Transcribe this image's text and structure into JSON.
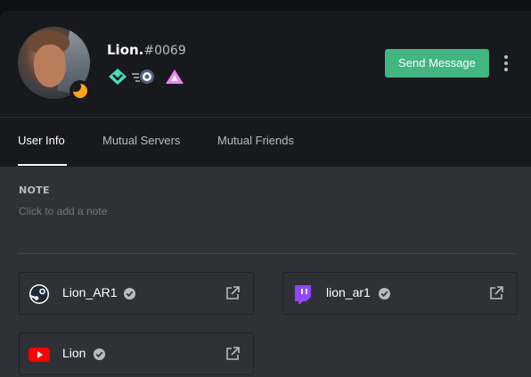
{
  "profile": {
    "username": "Lion.",
    "discriminator": "#0069",
    "status": "idle",
    "badges": [
      "hypesquad-balance-icon",
      "nitro-boost-icon",
      "early-supporter-icon"
    ]
  },
  "actions": {
    "send_message_label": "Send Message"
  },
  "tabs": [
    {
      "label": "User Info",
      "active": true
    },
    {
      "label": "Mutual Servers",
      "active": false
    },
    {
      "label": "Mutual Friends",
      "active": false
    }
  ],
  "note": {
    "label": "NOTE",
    "placeholder": "Click to add a note"
  },
  "connections": [
    {
      "service": "steam",
      "name": "Lion_AR1",
      "verified": true
    },
    {
      "service": "twitch",
      "name": "lion_ar1",
      "verified": true
    },
    {
      "service": "youtube",
      "name": "Lion",
      "verified": true
    }
  ],
  "colors": {
    "accent_green": "#43b581",
    "idle_status": "#faa61a",
    "twitch": "#9146ff",
    "youtube": "#ff0000",
    "header_bg": "#18191c",
    "body_bg": "#2f3136"
  }
}
